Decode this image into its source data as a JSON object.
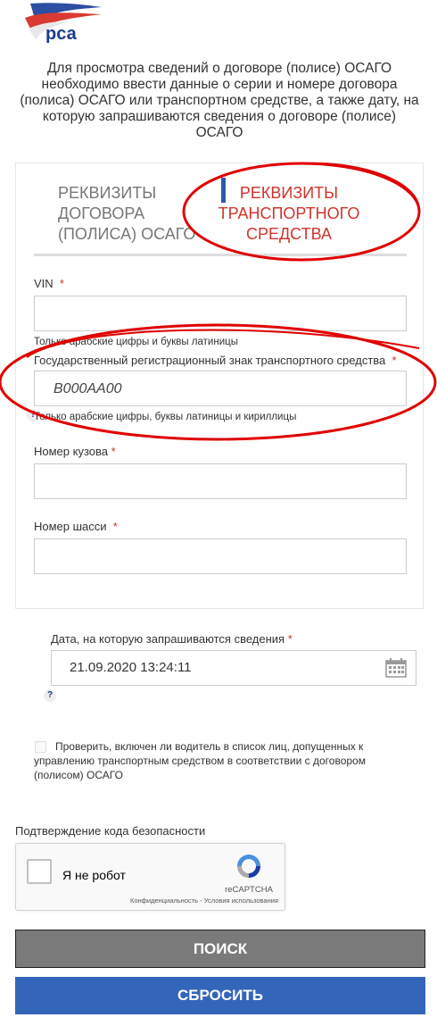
{
  "brand": {
    "logo_text": "рса"
  },
  "intro": {
    "text": "Для просмотра сведений о договоре (полисе) ОСАГО необходимо ввести данные о серии и номере договора (полиса) ОСАГО или транспортном средстве, а также дату, на которую запрашиваются сведения о договоре (полисе) ОСАГО"
  },
  "tabs": [
    {
      "label": "РЕКВИЗИТЫ ДОГОВОРА (ПОЛИСА) ОСАГО",
      "active": false
    },
    {
      "label": "РЕКВИЗИТЫ ТРАНСПОРТНОГО СРЕДСТВА",
      "active": true
    }
  ],
  "form": {
    "vin": {
      "label": "VIN",
      "required_mark": "*",
      "value": "",
      "hint": "Только арабские цифры и буквы латиницы"
    },
    "plate": {
      "label": "Государственный регистрационный знак транспортного средства",
      "required_mark": "*",
      "value": "В000АА00",
      "hint": "Только арабские цифры, буквы латиницы и кириллицы"
    },
    "body": {
      "label": "Номер кузова",
      "required_mark": "*",
      "value": ""
    },
    "chassis": {
      "label": "Номер шасси",
      "required_mark": "*",
      "value": ""
    }
  },
  "date": {
    "label": "Дата, на которую запрашиваются сведения",
    "required_mark": "*",
    "value": "21.09.2020 13:24:11",
    "help": "?"
  },
  "driver_check": {
    "label": "Проверить, включен ли водитель в список лиц, допущенных к управлению транспортным средством в соответствии с договором (полисом) ОСАГО",
    "checked": false
  },
  "captcha": {
    "title": "Подтверждение кода безопасности",
    "checkbox_label": "Я не робот",
    "brand": "reCAPTCHA",
    "links": "Конфиденциальность - Условия использования"
  },
  "buttons": {
    "search": "ПОИСК",
    "reset": "СБРОСИТЬ"
  },
  "colors": {
    "accent_red": "#d0342c",
    "accent_blue": "#3366bb",
    "search_gray": "#7a7a7a",
    "annotation_red": "#e00000"
  }
}
